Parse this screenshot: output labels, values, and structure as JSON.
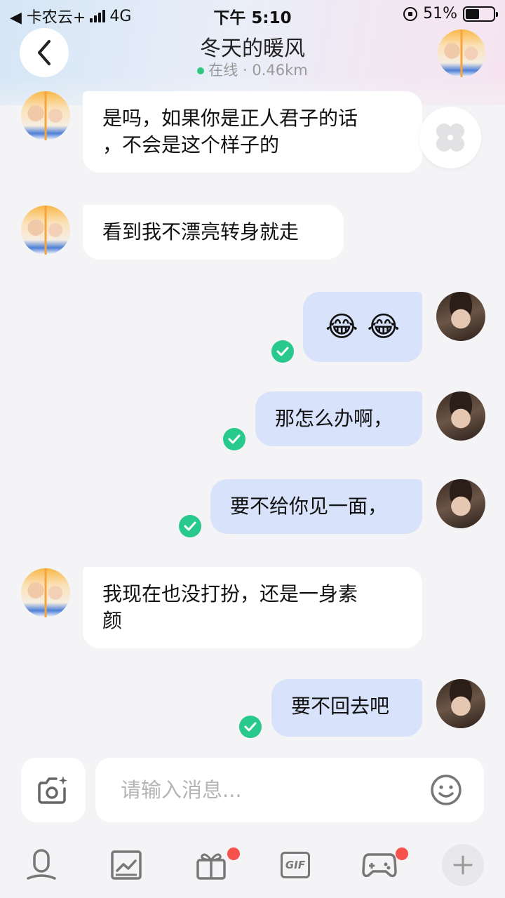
{
  "status_bar": {
    "carrier": "◀ 卡农云+",
    "network": "4G",
    "time": "下午 5:10",
    "battery": "51%"
  },
  "header": {
    "title": "冬天的暖风",
    "status": "在线 · 0.46km",
    "online_color": "#2ec77a"
  },
  "messages": [
    {
      "side": "in",
      "text_lines": [
        "是吗，如果你是正人君子的话",
        "，不会是这个样子的"
      ],
      "read": false
    },
    {
      "side": "in",
      "text_lines": [
        "看到我不漂亮转身就走"
      ],
      "read": false
    },
    {
      "side": "out",
      "text_lines": [
        "😂 😂"
      ],
      "read": true
    },
    {
      "side": "out",
      "text_lines": [
        "那怎么办啊，"
      ],
      "read": true
    },
    {
      "side": "out",
      "text_lines": [
        "要不给你见一面，"
      ],
      "read": true
    },
    {
      "side": "in",
      "text_lines": [
        "我现在也没打扮，还是一身素",
        "颜"
      ],
      "read": false
    },
    {
      "side": "out",
      "text_lines": [
        "要不回去吧"
      ],
      "read": true
    }
  ],
  "input": {
    "placeholder": "请输入消息..."
  },
  "toolbar": {
    "items": [
      "voice-icon",
      "photo-icon",
      "gift-icon",
      "gif-icon",
      "game-icon",
      "plus-icon"
    ],
    "gif_label": "GIF",
    "badge_color": "#f4524a"
  },
  "colors": {
    "out_bubble": "#d8e2fb",
    "in_bubble": "#ffffff",
    "read_check": "#27c98c"
  }
}
